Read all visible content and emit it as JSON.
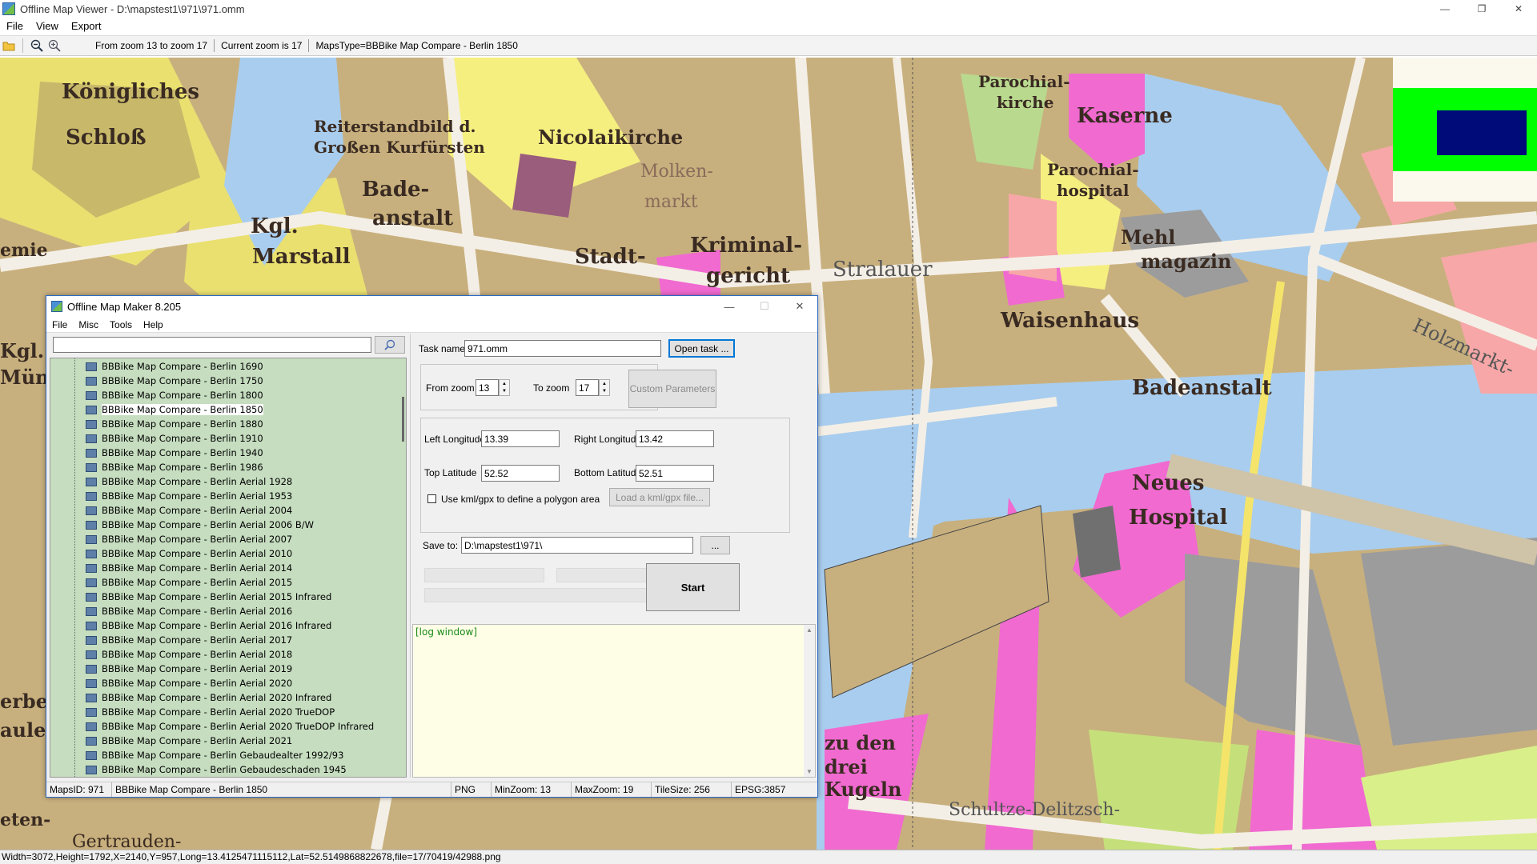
{
  "window": {
    "title": "Offline Map Viewer - D:\\mapstest1\\971\\971.omm",
    "min": "—",
    "max": "❐",
    "close": "✕"
  },
  "menu": [
    "File",
    "View",
    "Export"
  ],
  "toolbar": {
    "zoom_range": "From zoom 13 to zoom 17",
    "current_zoom": "Current zoom is 17",
    "maps_type": "MapsType=BBBike Map Compare - Berlin 1850"
  },
  "map_labels": [
    {
      "text": "Königliches",
      "size": 26
    },
    {
      "text": "Schloß",
      "size": 26
    },
    {
      "text": "Reiterstandbild d.",
      "size": 20
    },
    {
      "text": "Großen Kurfürsten",
      "size": 20
    },
    {
      "text": "Nicolaikirche",
      "size": 24
    },
    {
      "text": "Parochial-",
      "size": 20
    },
    {
      "text": "kirche",
      "size": 20
    },
    {
      "text": "Kaserne",
      "size": 26
    },
    {
      "text": "Parochial-",
      "size": 20
    },
    {
      "text": "hospital",
      "size": 20
    },
    {
      "text": "Bade-",
      "size": 26
    },
    {
      "text": "anstalt",
      "size": 26
    },
    {
      "text": "Kgl.",
      "size": 26
    },
    {
      "text": "Marstall",
      "size": 26
    },
    {
      "text": "Stadt-",
      "size": 26
    },
    {
      "text": "Kriminal-",
      "size": 26
    },
    {
      "text": "gericht",
      "size": 26
    },
    {
      "text": "Mehl",
      "size": 24
    },
    {
      "text": "magazin",
      "size": 24
    },
    {
      "text": "Waisenhaus",
      "size": 26
    },
    {
      "text": "Badeanstalt",
      "size": 26
    },
    {
      "text": "Neues",
      "size": 26
    },
    {
      "text": "Hospital",
      "size": 26
    },
    {
      "text": "zu den",
      "size": 24
    },
    {
      "text": "drei",
      "size": 24
    },
    {
      "text": "Kugeln",
      "size": 24
    },
    {
      "text": "Schultze-Delitzsch-",
      "size": 22
    },
    {
      "text": "Holzmarkt-",
      "size": 24
    },
    {
      "text": "Stralauer",
      "size": 26
    },
    {
      "text": "Molken-",
      "size": 22
    },
    {
      "text": "markt",
      "size": 22
    },
    {
      "text": "emie",
      "size": 22
    },
    {
      "text": "Kgl.",
      "size": 24
    },
    {
      "text": "Mün",
      "size": 24
    },
    {
      "text": "erbe",
      "size": 24
    },
    {
      "text": "aule",
      "size": 24
    },
    {
      "text": "eten-",
      "size": 22
    },
    {
      "text": "Gertrauden-",
      "size": 22
    }
  ],
  "dialog": {
    "title": "Offline Map Maker 8.205",
    "min": "—",
    "max": "☐",
    "close": "✕",
    "menu": [
      "File",
      "Misc",
      "Tools",
      "Help"
    ],
    "search_value": "",
    "tree_items": [
      "BBBike Map Compare - Berlin 1690",
      "BBBike Map Compare - Berlin 1750",
      "BBBike Map Compare - Berlin 1800",
      "BBBike Map Compare - Berlin 1850",
      "BBBike Map Compare - Berlin 1880",
      "BBBike Map Compare - Berlin 1910",
      "BBBike Map Compare - Berlin 1940",
      "BBBike Map Compare - Berlin 1986",
      "BBBike Map Compare - Berlin Aerial 1928",
      "BBBike Map Compare - Berlin Aerial 1953",
      "BBBike Map Compare - Berlin Aerial 2004",
      "BBBike Map Compare - Berlin Aerial 2006 B/W",
      "BBBike Map Compare - Berlin Aerial 2007",
      "BBBike Map Compare - Berlin Aerial 2010",
      "BBBike Map Compare - Berlin Aerial 2014",
      "BBBike Map Compare - Berlin Aerial 2015",
      "BBBike Map Compare - Berlin Aerial 2015 Infrared",
      "BBBike Map Compare - Berlin Aerial 2016",
      "BBBike Map Compare - Berlin Aerial 2016 Infrared",
      "BBBike Map Compare - Berlin Aerial 2017",
      "BBBike Map Compare - Berlin Aerial 2018",
      "BBBike Map Compare - Berlin Aerial 2019",
      "BBBike Map Compare - Berlin Aerial 2020",
      "BBBike Map Compare - Berlin Aerial 2020 Infrared",
      "BBBike Map Compare - Berlin Aerial 2020 TrueDOP",
      "BBBike Map Compare - Berlin Aerial 2020 TrueDOP Infrared",
      "BBBike Map Compare - Berlin Aerial 2021",
      "BBBike Map Compare - Berlin Gebaudealter 1992/93",
      "BBBike Map Compare - Berlin Gebaudeschaden 1945"
    ],
    "selected_index": 3,
    "task_name_label": "Task name",
    "task_name_value": "971.omm",
    "open_task": "Open task ...",
    "from_zoom_label": "From zoom",
    "from_zoom_value": "13",
    "to_zoom_label": "To zoom",
    "to_zoom_value": "17",
    "custom_params": "Custom Parameters",
    "left_lon_label": "Left Longitude",
    "left_lon_value": "13.39",
    "right_lon_label": "Right Longitude",
    "right_lon_value": "13.42",
    "top_lat_label": "Top Latitude",
    "top_lat_value": "52.52",
    "bottom_lat_label": "Bottom Latitude",
    "bottom_lat_value": "52.51",
    "kml_label": "Use kml/gpx to define a polygon area",
    "kml_checked": false,
    "load_kml": "Load a kml/gpx file...",
    "save_to_label": "Save to:",
    "save_to_value": "D:\\mapstest1\\971\\",
    "browse": "...",
    "start": "Start",
    "log_text": "[log window]",
    "status": {
      "maps_id": "MapsID: 971",
      "maps_name": "BBBike Map Compare - Berlin 1850",
      "format": "PNG",
      "min_zoom": "MinZoom: 13",
      "max_zoom": "MaxZoom: 19",
      "tile_size": "TileSize: 256",
      "epsg": "EPSG:3857"
    }
  },
  "statusbar": "Width=3072,Height=1792,X=2140,Y=957,Long=13.4125471115112,Lat=52.5149868822678,file=17/70419/42988.png",
  "colors": {
    "map_bg": "#c8b07e",
    "water": "#a9cdee",
    "pink": "#f06ad0",
    "yellow": "#f5ef80",
    "overview_green": "#00ff00",
    "overview_navy": "#000b7a",
    "tree_bg": "#c6ddc0",
    "log_bg": "#fefee6"
  }
}
